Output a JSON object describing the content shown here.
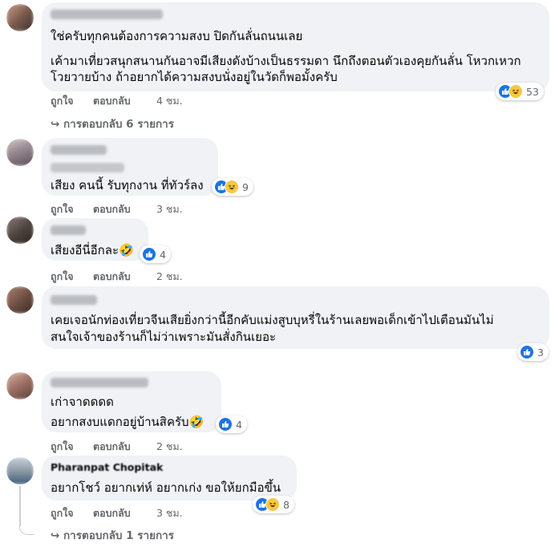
{
  "comments": [
    {
      "lines": [
        "ใช่ครับทุกคนต้องการความสงบ ปิดกันลั่นถนนเลย",
        "",
        "เค้ามาเที่ยวสนุกสนานกันอาจมีเสียงดังบ้างเป็นธรรมดา นึกถึงตอนตัวเองคุยกันลั่น โหวกเหวก",
        "โวยวายบ้าง ถ้าอยากได้ความสงบนั่งอยู่ในวัดก็พอมั้งครับ"
      ],
      "like_label": "ถูกใจ",
      "reply_label": "ตอบกลับ",
      "time": "4 ชม.",
      "reaction_count": "53",
      "replies_label": "การตอบกลับ 6 รายการ"
    },
    {
      "lines": [
        "เสียง คนนี้ รับทุกงาน ที่ทัวร์ลง"
      ],
      "like_label": "ถูกใจ",
      "reply_label": "ตอบกลับ",
      "time": "3 ชม.",
      "reaction_count": "9"
    },
    {
      "lines": [
        "เสียงอีนี่อีกละ🤣"
      ],
      "like_label": "ถูกใจ",
      "reply_label": "ตอบกลับ",
      "time": "2 ชม.",
      "reaction_count": "4"
    },
    {
      "lines": [
        "เคยเจอนักท่องเที่ยวจีนเสียยิ่งกว่านี้อีกคับแม่งสูบบุหรี่ในร้านเลยพอเด็กเข้าไปเตือนมันไม่",
        "สนใจเจ้าของร้านก็ไม่ว่าเพราะมันสั่งกินเยอะ"
      ],
      "reaction_count": "3"
    },
    {
      "lines": [
        "เก่าจาดดดด",
        "อยากสงบแดกอยู่บ้านสิครับ🤣"
      ],
      "like_label": "ถูกใจ",
      "reply_label": "ตอบกลับ",
      "time": "2 ชม.",
      "reaction_count": "4"
    },
    {
      "author": "Pharanpat Chopitak",
      "lines": [
        "อยากโชว์ อยากเท่ห์ อยากเก่ง ขอให้ยกมือขึ้น"
      ],
      "like_label": "ถูกใจ",
      "reply_label": "ตอบกลับ",
      "time": "3 ชม.",
      "reaction_count": "8",
      "replies_label": "การตอบกลับ 1 รายการ"
    }
  ],
  "colors": {
    "bubble": "#f0f2f5",
    "meta_text": "#65676b",
    "like_blue": "#1b74e4",
    "haha_yellow": "#f7c744"
  },
  "icons": [
    "like-icon",
    "haha-icon",
    "reply-arrow-icon"
  ]
}
